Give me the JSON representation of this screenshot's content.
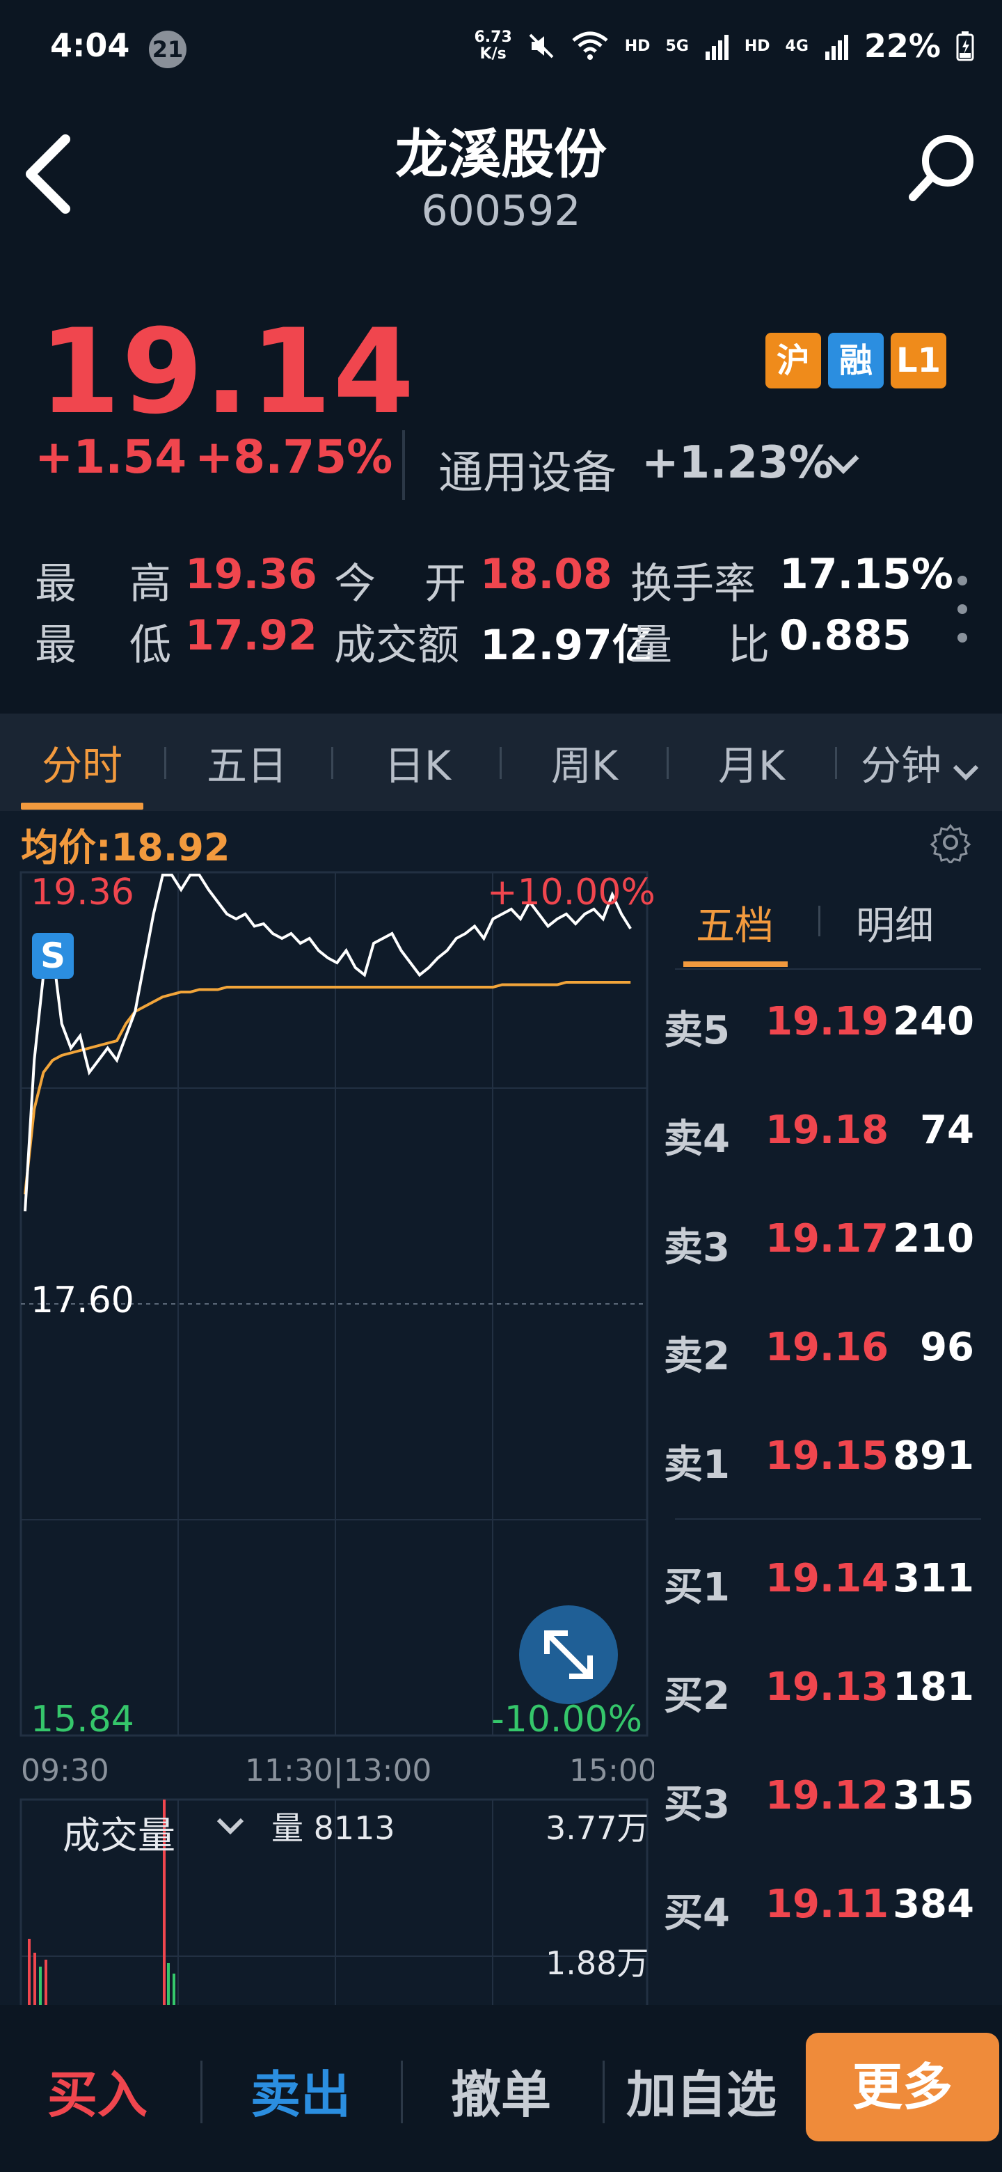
{
  "status_bar": {
    "time": "4:04",
    "notification_count": "21",
    "net_speed_value": "6.73",
    "net_speed_unit": "K/s",
    "hd1": "HD",
    "net1": "5G",
    "hd2": "HD",
    "net2": "4G",
    "battery": "22%"
  },
  "header": {
    "title": "龙溪股份",
    "code": "600592"
  },
  "quote": {
    "price": "19.14",
    "change": "+1.54",
    "change_pct": "+8.75%",
    "sector_name": "通用设备",
    "sector_change": "+1.23%",
    "badges": [
      "沪",
      "融",
      "L1"
    ]
  },
  "stats": {
    "high_label1": "最",
    "high_label2": "高",
    "high": "19.36",
    "open_label1": "今",
    "open_label2": "开",
    "open": "18.08",
    "turnover_label": "换手率",
    "turnover": "17.15%",
    "low_label1": "最",
    "low_label2": "低",
    "low": "17.92",
    "amount_label": "成交额",
    "amount": "12.97亿",
    "ratio_label1": "量",
    "ratio_label2": "比",
    "ratio": "0.885"
  },
  "tabs": [
    "分时",
    "五日",
    "日K",
    "周K",
    "月K",
    "分钟"
  ],
  "chart": {
    "avg_label": "均价:18.92",
    "y_top": "19.36",
    "y_mid": "17.60",
    "y_bottom": "15.84",
    "pct_top": "+10.00%",
    "pct_bottom": "-10.00%",
    "x_start": "09:30",
    "x_mid": "11:30|13:00",
    "x_end": "15:00",
    "s_marker": "S"
  },
  "chart_data": {
    "type": "line",
    "ylim": [
      15.84,
      19.36
    ],
    "series": [
      {
        "values": [
          17.98,
          18.6,
          18.95,
          19.05,
          18.75,
          18.65,
          18.7,
          18.55,
          18.6,
          18.65,
          18.6,
          18.7,
          18.8,
          19.0,
          19.2,
          19.36,
          19.36,
          19.3,
          19.36,
          19.36,
          19.3,
          19.25,
          19.2,
          19.18,
          19.2,
          19.15,
          19.16,
          19.12,
          19.1,
          19.12,
          19.08,
          19.1,
          19.05,
          19.02,
          19.0,
          19.05,
          18.98,
          18.95,
          19.08,
          19.1,
          19.12,
          19.05,
          19.0,
          18.95,
          18.98,
          19.02,
          19.05,
          19.1,
          19.12,
          19.15,
          19.1,
          19.18,
          19.2,
          19.22,
          19.18,
          19.25,
          19.2,
          19.15,
          19.18,
          19.2,
          19.16,
          19.2,
          19.22,
          19.18,
          19.28,
          19.2,
          19.14
        ]
      },
      {
        "values": [
          18.05,
          18.4,
          18.55,
          18.6,
          18.62,
          18.63,
          18.64,
          18.65,
          18.66,
          18.67,
          18.68,
          18.75,
          18.8,
          18.82,
          18.84,
          18.86,
          18.87,
          18.88,
          18.88,
          18.89,
          18.89,
          18.89,
          18.9,
          18.9,
          18.9,
          18.9,
          18.9,
          18.9,
          18.9,
          18.9,
          18.9,
          18.9,
          18.9,
          18.9,
          18.9,
          18.9,
          18.9,
          18.9,
          18.9,
          18.9,
          18.9,
          18.9,
          18.9,
          18.9,
          18.9,
          18.9,
          18.9,
          18.9,
          18.9,
          18.9,
          18.9,
          18.9,
          18.91,
          18.91,
          18.91,
          18.91,
          18.91,
          18.91,
          18.91,
          18.92,
          18.92,
          18.92,
          18.92,
          18.92,
          18.92,
          18.92,
          18.92
        ]
      }
    ]
  },
  "volume": {
    "label": "成交量",
    "amount_label": "量 8113",
    "max": "3.77万",
    "mid": "1.88万"
  },
  "book": {
    "tab_active": "五档",
    "tab_inactive": "明细",
    "asks": [
      {
        "label": "卖5",
        "price": "19.19",
        "vol": "240"
      },
      {
        "label": "卖4",
        "price": "19.18",
        "vol": "74"
      },
      {
        "label": "卖3",
        "price": "19.17",
        "vol": "210"
      },
      {
        "label": "卖2",
        "price": "19.16",
        "vol": "96"
      },
      {
        "label": "卖1",
        "price": "19.15",
        "vol": "891"
      }
    ],
    "bids": [
      {
        "label": "买1",
        "price": "19.14",
        "vol": "311"
      },
      {
        "label": "买2",
        "price": "19.13",
        "vol": "181"
      },
      {
        "label": "买3",
        "price": "19.12",
        "vol": "315"
      },
      {
        "label": "买4",
        "price": "19.11",
        "vol": "384"
      }
    ]
  },
  "actions": {
    "buy": "买入",
    "sell": "卖出",
    "cancel": "撤单",
    "watch": "加自选",
    "more": "更多"
  }
}
